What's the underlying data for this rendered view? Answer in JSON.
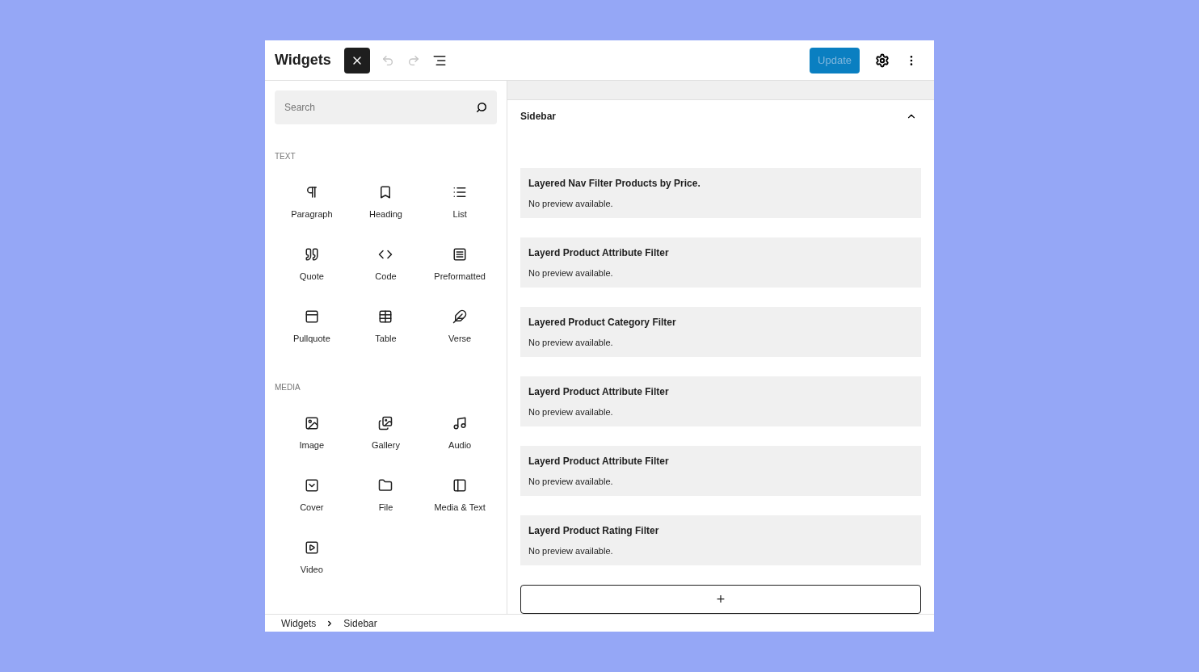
{
  "header": {
    "title": "Widgets",
    "inserter_toggle": {
      "pressed": true
    },
    "undo": {
      "disabled": true
    },
    "redo": {
      "disabled": true
    },
    "update_button": {
      "label": "Update",
      "disabled": true
    }
  },
  "inserter": {
    "search": {
      "placeholder": "Search"
    },
    "categories": [
      {
        "label": "TEXT",
        "blocks": [
          "Paragraph",
          "Heading",
          "List",
          "Quote",
          "Code",
          "Preformatted",
          "Pullquote",
          "Table",
          "Verse"
        ]
      },
      {
        "label": "MEDIA",
        "blocks": [
          "Image",
          "Gallery",
          "Audio",
          "Cover",
          "File",
          "Media & Text",
          "Video"
        ]
      }
    ]
  },
  "sidebar_panel": {
    "title": "Sidebar",
    "expanded": true,
    "widgets": [
      {
        "title": "Layered Nav Filter Products by Price.",
        "preview": "No preview available."
      },
      {
        "title": "Layerd Product Attribute Filter",
        "preview": "No preview available."
      },
      {
        "title": "Layered Product Category Filter",
        "preview": "No preview available."
      },
      {
        "title": "Layerd Product Attribute Filter",
        "preview": "No preview available."
      },
      {
        "title": "Layerd Product Attribute Filter",
        "preview": "No preview available."
      },
      {
        "title": "Layerd Product Rating Filter",
        "preview": "No preview available."
      }
    ],
    "add_block": "+"
  },
  "breadcrumb": [
    "Widgets",
    "Sidebar"
  ]
}
